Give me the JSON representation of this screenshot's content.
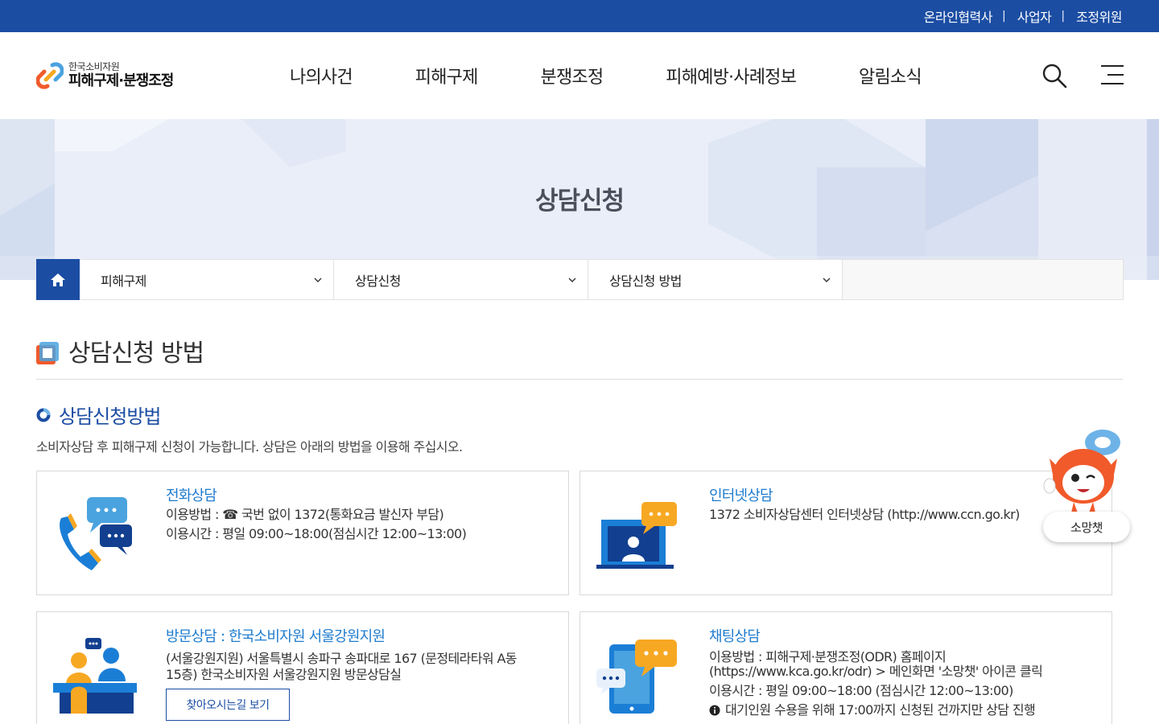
{
  "topbar": {
    "links": [
      "온라인협력사",
      "사업자",
      "조정위원"
    ],
    "bg_color": "#1b4da3"
  },
  "header": {
    "logo_sub": "한국소비자원",
    "logo_main": "피해구제·분쟁조정",
    "nav": [
      "나의사건",
      "피해구제",
      "분쟁조정",
      "피해예방·사례정보",
      "알림소식"
    ],
    "icons": [
      "search-icon",
      "menu-icon"
    ]
  },
  "hero": {
    "title": "상담신청"
  },
  "breadcrumb": {
    "home_icon": "home-icon",
    "items": [
      "피해구제",
      "상담신청",
      "상담신청 방법"
    ]
  },
  "page": {
    "heading": "상담신청 방법",
    "section_title": "상담신청방법",
    "intro": "소비자상담 후 피해구제 신청이 가능합니다. 상담은 아래의 방법을 이용해 주십시오."
  },
  "cards": {
    "phone": {
      "title": "전화상담",
      "line1": "이용방법 : ☎ 국번 없이 1372(통화요금 발신자 부담)",
      "line2": "이용시간 : 평일 09:00~18:00(점심시간 12:00~13:00)"
    },
    "internet": {
      "title": "인터넷상담",
      "line1": "1372 소비자상담센터 인터넷상담 (http://www.ccn.go.kr)"
    },
    "visit": {
      "title": "방문상담 : 한국소비자원 서울강원지원",
      "line1": "(서울강원지원) 서울특별시 송파구 송파대로 167 (문정테라타워 A동",
      "line2": "15층) 한국소비자원 서울강원지원 방문상담실",
      "button": "찾아오시는길 보기"
    },
    "chat": {
      "title": "채팅상담",
      "line1": "이용방법 : 피해구제·분쟁조정(ODR) 홈페이지",
      "line2": "(https://www.kca.go.kr/odr) > 메인화면 '소망챗' 아이콘 클릭",
      "line3": "이용시간 : 평일 09:00~18:00 (점심시간 12:00~13:00)",
      "notice": "대기인원 수용을 위해 17:00까지 신청된 건까지만 상담 진행"
    }
  },
  "chatbot": {
    "label": "소망챗"
  },
  "colors": {
    "primary": "#1b4da3",
    "link": "#1f7ccf",
    "accent": "#f15a2b"
  }
}
